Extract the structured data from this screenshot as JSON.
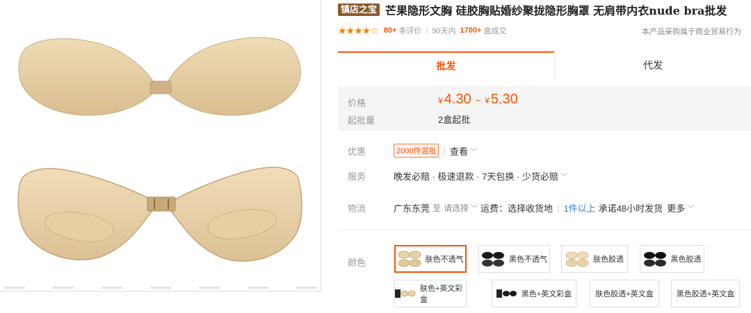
{
  "product": {
    "shop_badge": "镇店之宝",
    "title": "芒果隐形文胸 硅胶胸贴婚纱聚拢隐形胸罩 无肩带内衣nude bra批发"
  },
  "rating": {
    "stars": "★★★★☆",
    "review_count": "80+",
    "review_label": "条评价",
    "days_label": "90天内",
    "deals_count": "1700+",
    "deals_label": "盒成交",
    "biz_note": "本产品采购属于商业贸易行为"
  },
  "tabs": [
    {
      "label": "批发"
    },
    {
      "label": "代发"
    }
  ],
  "price": {
    "label": "价格",
    "currency": "¥",
    "min": "4.30",
    "range_sep": "~",
    "max": "5.30",
    "moq_label": "起批量",
    "moq_value": "2盒起批"
  },
  "discount": {
    "label": "优惠",
    "tag": "2000件混批",
    "view": "查看"
  },
  "service": {
    "label": "服务",
    "text": "晚发必赔 · 极速退款 · 7天包换 · 少货必赔"
  },
  "logistics": {
    "label": "物流",
    "origin": "广东东莞",
    "to": "至",
    "dest": "请选择",
    "fee": "运费：选择收货地",
    "qty": "1件以上",
    "promise": "承诺48小时发货",
    "more": "更多"
  },
  "colors": {
    "label": "颜色",
    "options": [
      {
        "name": "肤色不透气"
      },
      {
        "name": "黑色不透气"
      },
      {
        "name": "肤色胶透"
      },
      {
        "name": "黑色胶透"
      },
      {
        "name": "肤色+英文彩盒"
      },
      {
        "name": "黑色+英文彩盒"
      },
      {
        "name": "肤色胶透+英文盒"
      },
      {
        "name": "黑色胶透+英文盒"
      }
    ],
    "selected_index": 0
  },
  "palette": {
    "accent": "#ff5000",
    "nude": "#e8d3a8",
    "black": "#1a1a1a"
  }
}
